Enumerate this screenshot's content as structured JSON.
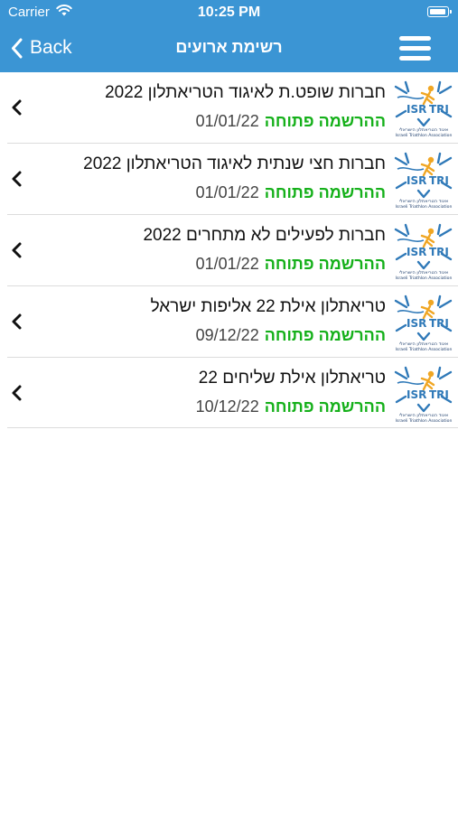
{
  "status_bar": {
    "carrier": "Carrier",
    "time": "10:25 PM"
  },
  "nav": {
    "back_label": "Back",
    "title": "רשימת ארועים"
  },
  "logo_text": {
    "brand_left": "ISR",
    "brand_right": "TRI",
    "caption_he": "איגוד הטריאתלון הישראלי",
    "caption_en": "Israeli Triathlon Association"
  },
  "events": [
    {
      "title": "חברות שופט.ת לאיגוד הטריאתלון 2022",
      "status": "ההרשמה פתוחה",
      "date": "01/01/22"
    },
    {
      "title": "חברות חצי שנתית לאיגוד הטריאתלון 2022",
      "status": "ההרשמה פתוחה",
      "date": "01/01/22"
    },
    {
      "title": "חברות לפעילים לא מתחרים 2022",
      "status": "ההרשמה פתוחה",
      "date": "01/01/22"
    },
    {
      "title": "טריאתלון אילת 22 אליפות ישראל",
      "status": "ההרשמה פתוחה",
      "date": "09/12/22"
    },
    {
      "title": "טריאתלון אילת שליחים 22",
      "status": "ההרשמה פתוחה",
      "date": "10/12/22"
    }
  ],
  "colors": {
    "header": "#3b95d4",
    "status_open": "#15b01a"
  }
}
